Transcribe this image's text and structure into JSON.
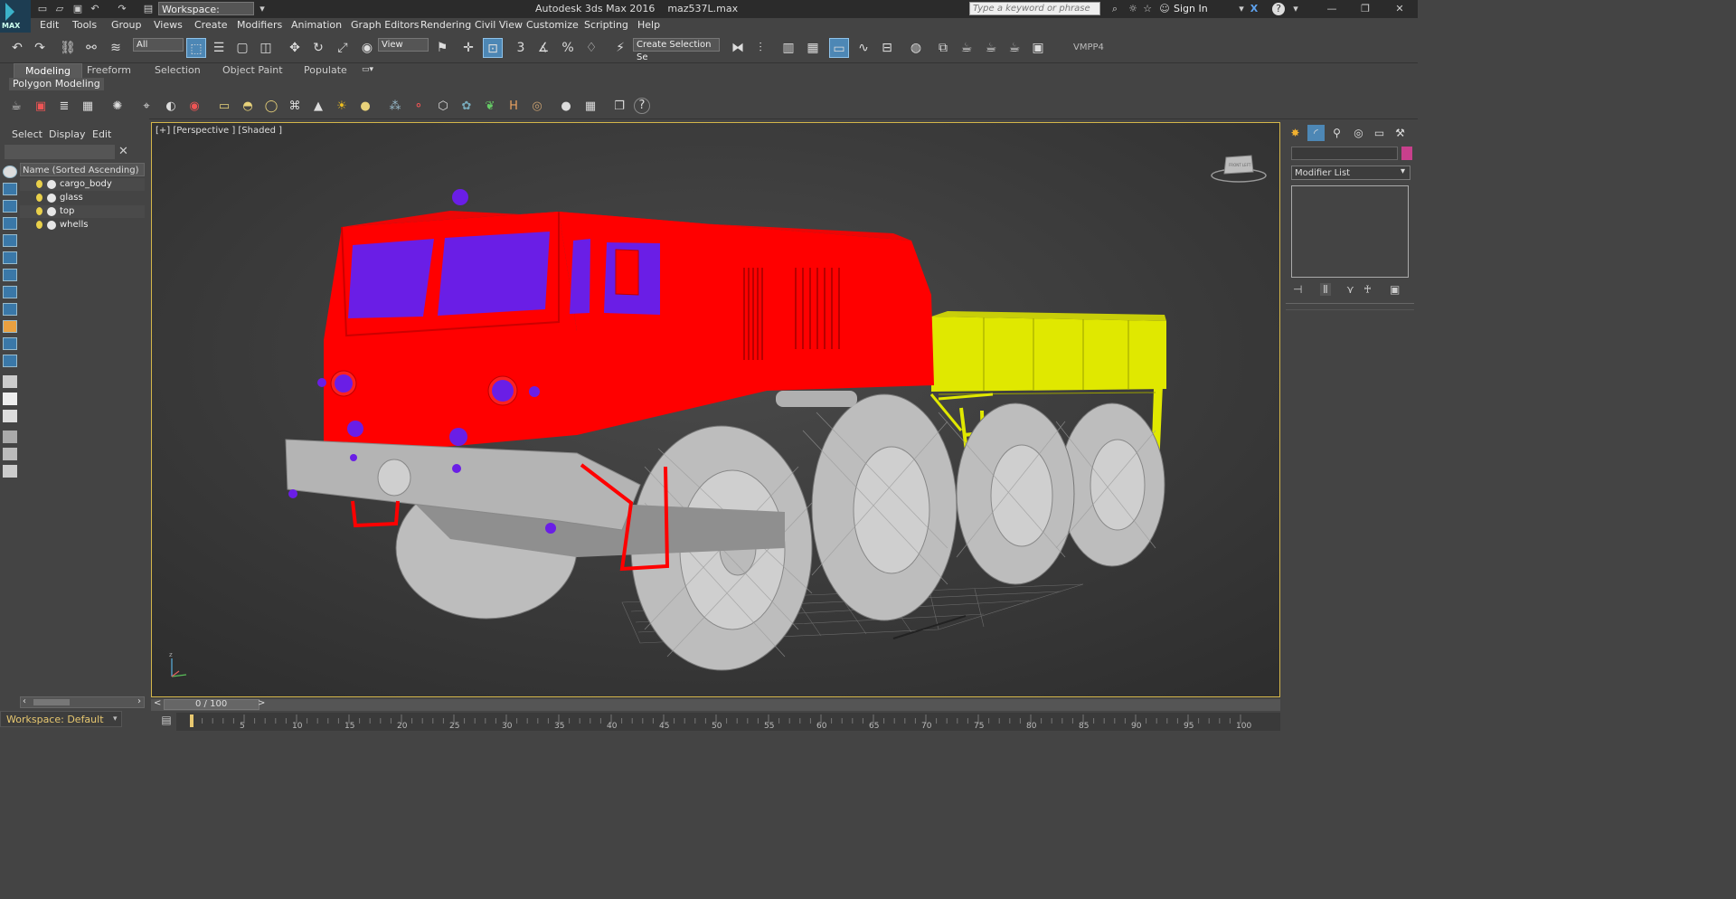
{
  "window": {
    "app_title": "Autodesk 3ds Max 2016",
    "file_name": "maz537L.max",
    "workspace": "Workspace: Default",
    "search_placeholder": "Type a keyword or phrase",
    "sign_in": "Sign In",
    "logo_text": "MAX"
  },
  "menu": [
    "Edit",
    "Tools",
    "Group",
    "Views",
    "Create",
    "Modifiers",
    "Animation",
    "Graph Editors",
    "Rendering",
    "Civil View",
    "Customize",
    "Scripting",
    "Help"
  ],
  "toolbar": {
    "filter_value": "All",
    "ref_coord_value": "View",
    "snap_label": "3",
    "angle_label": "n",
    "percent_label": "%",
    "selection_set_value": "Create Selection Se",
    "plugin_label": "VMPP4"
  },
  "ribbon": {
    "tabs": [
      "Modeling",
      "Freeform",
      "Selection",
      "Object Paint",
      "Populate"
    ],
    "panel": "Polygon Modeling"
  },
  "scene_explorer": {
    "tabs": [
      "Select",
      "Display",
      "Edit"
    ],
    "column_header": "Name (Sorted Ascending)",
    "items": [
      "cargo_body",
      "glass",
      "top",
      "whells"
    ]
  },
  "viewport": {
    "label": "[+] [Perspective ] [Shaded ]",
    "viewcube_label": "FRONT LEFT",
    "colors": {
      "cab": "#ff0000",
      "glass": "#6a1ee6",
      "cargo": "#e0e800",
      "wheels": "#bdbdbd",
      "bumper": "#b4b4b4"
    }
  },
  "timeline": {
    "frame_display": "0 / 100",
    "ticks": [
      5,
      10,
      15,
      20,
      25,
      30,
      35,
      40,
      45,
      50,
      55,
      60,
      65,
      70,
      75,
      80,
      85,
      90,
      95,
      100
    ]
  },
  "command_panel": {
    "modifier_list": "Modifier List",
    "object_color": "#c8408c"
  },
  "status": {
    "workspace": "Workspace: Default"
  }
}
